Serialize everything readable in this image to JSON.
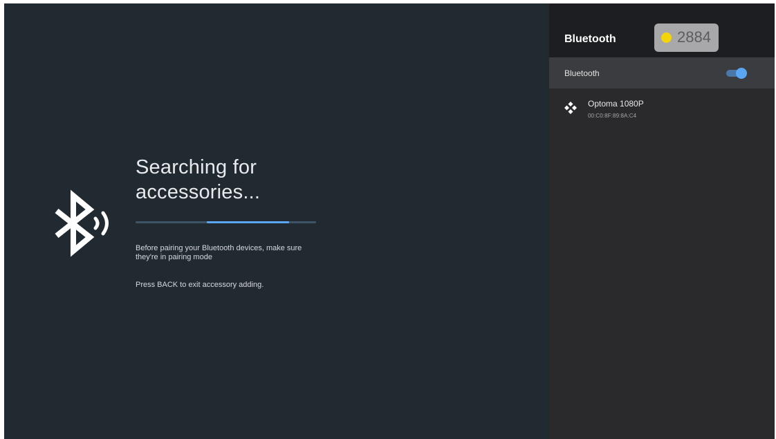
{
  "main": {
    "title": "Searching for accessories...",
    "progress": 0.46,
    "hint": "Before pairing your Bluetooth devices, make sure they're in pairing mode",
    "back_hint": "Press BACK to exit accessory adding."
  },
  "panel": {
    "title": "Bluetooth",
    "coins": "2884",
    "toggle_label": "Bluetooth",
    "toggle_on": true,
    "devices": [
      {
        "name": "Optoma 1080P",
        "mac": "00:C0:8F:89:8A:C4",
        "icon": "gamepad-icon"
      }
    ]
  },
  "colors": {
    "background": "#212a31",
    "panel": "#2a2a2d",
    "accent": "#5aa6f2",
    "coin": "#f4d50b"
  }
}
